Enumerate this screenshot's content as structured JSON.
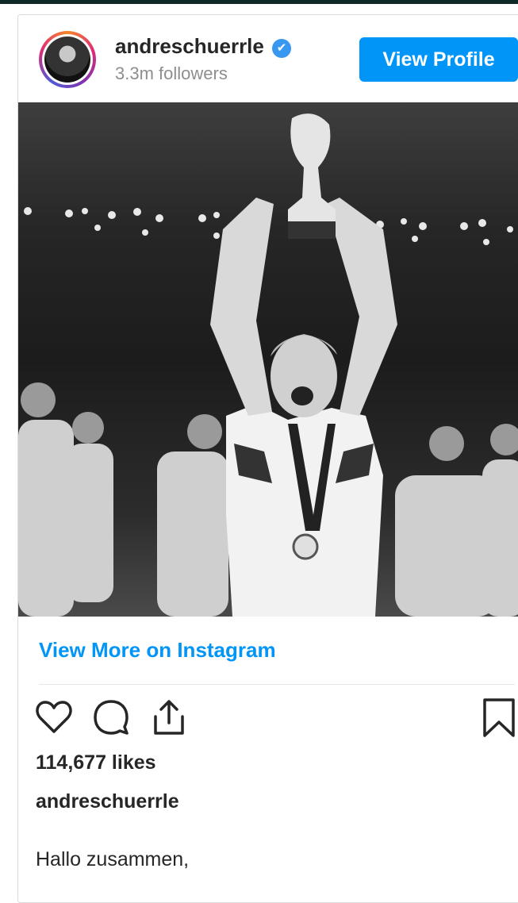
{
  "post": {
    "username": "andreschuerrle",
    "followers": "3.3m followers",
    "view_profile_label": "View Profile",
    "verified_icon": "✔",
    "view_more_label": "View More on Instagram",
    "likes": "114,677 likes",
    "caption_username": "andreschuerrle",
    "caption_text": "Hallo zusammen,"
  },
  "icons": {
    "like": "heart-icon",
    "comment": "comment-icon",
    "share": "share-icon",
    "save": "bookmark-icon",
    "verified": "verified-badge-icon"
  },
  "colors": {
    "accent": "#0095f6",
    "verified": "#3897f0",
    "text": "#262626",
    "muted": "#8e8e8e"
  }
}
